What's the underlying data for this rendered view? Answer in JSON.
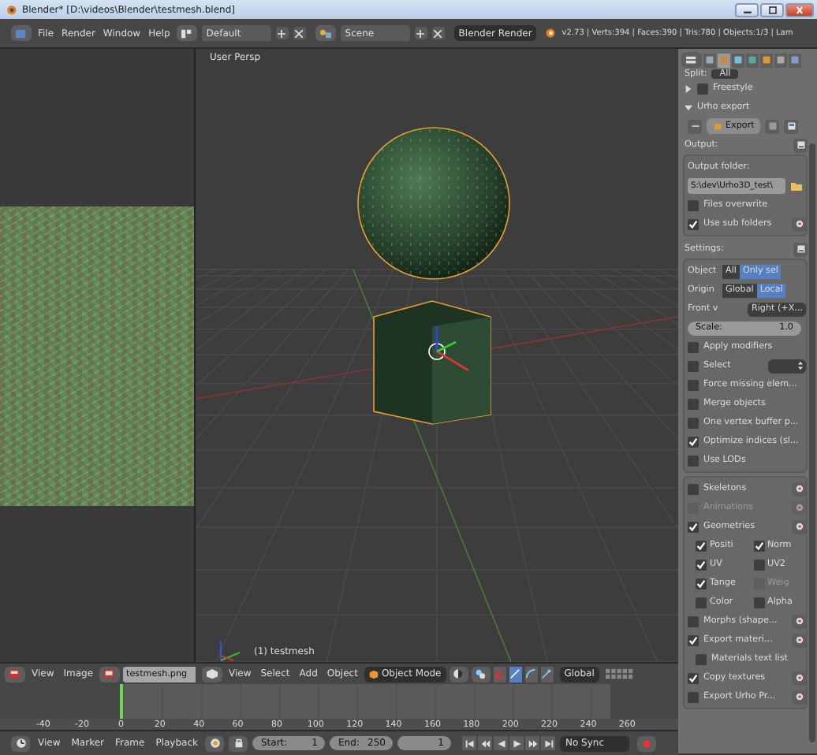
{
  "window": {
    "title": "Blender* [D:\\videos\\Blender\\testmesh.blend]"
  },
  "top_bar": {
    "menus": [
      "File",
      "Render",
      "Window",
      "Help"
    ],
    "layout": "Default",
    "scene": "Scene",
    "engine": "Blender Render",
    "stats": "v2.73 | Verts:394 | Faces:390 | Tris:780 | Objects:1/3 | Lam"
  },
  "image_editor": {
    "menus": [
      "View",
      "Image"
    ],
    "image_name": "testmesh.png"
  },
  "viewport": {
    "view_label": "User Persp",
    "object_label": "(1) testmesh",
    "menus": [
      "View",
      "Select",
      "Add",
      "Object"
    ],
    "mode": "Object Mode",
    "orientation": "Global"
  },
  "properties": {
    "tabs": [
      {
        "selected": false
      },
      {
        "selected": true
      },
      {
        "selected": false
      },
      {
        "selected": false
      },
      {
        "selected": false
      },
      {
        "selected": false
      },
      {
        "selected": false
      }
    ],
    "split": {
      "label": "Split:",
      "value": "All"
    },
    "freestyle": {
      "title": "Freestyle",
      "expanded": false,
      "checked": false
    },
    "urho_export": {
      "title": "Urho export",
      "expanded": true,
      "export_button": "Export",
      "sections": [
        {
          "title": "Output:",
          "rows": [
            {
              "kind": "label",
              "label": "Output folder:"
            },
            {
              "kind": "field",
              "value": "S:\\dev\\Urho3D_test\\"
            },
            {
              "kind": "checkbox",
              "label": "Files overwrite",
              "checked": false,
              "disabled": false,
              "icon_button": false
            },
            {
              "kind": "checkbox",
              "label": "Use sub folders",
              "checked": true,
              "disabled": false,
              "icon_button": true
            }
          ]
        },
        {
          "title": "Settings:",
          "rows": [
            {
              "kind": "toggle",
              "label": "Object",
              "options": [
                {
                  "label": "All",
                  "selected": false
                },
                {
                  "label": "Only sel",
                  "selected": true
                }
              ]
            },
            {
              "kind": "toggle",
              "label": "Origin",
              "options": [
                {
                  "label": "Global",
                  "selected": false
                },
                {
                  "label": "Local",
                  "selected": true
                }
              ]
            },
            {
              "kind": "dropdown",
              "label": "Front v",
              "value": "Right (+X..."
            },
            {
              "kind": "slider",
              "label": "Scale:",
              "value": "1.0"
            },
            {
              "kind": "checkbox",
              "label": "Apply modifiers",
              "checked": false,
              "disabled": false,
              "icon_button": false
            },
            {
              "kind": "checkbox_dropdown",
              "label": "Select",
              "checked": false,
              "disabled": false
            },
            {
              "kind": "checkbox",
              "label": "Force missing elem...",
              "checked": false,
              "disabled": false,
              "icon_button": false
            },
            {
              "kind": "checkbox",
              "label": "Merge objects",
              "checked": false,
              "disabled": false,
              "icon_button": false
            },
            {
              "kind": "checkbox",
              "label": "One vertex buffer p...",
              "checked": false,
              "disabled": false,
              "icon_button": false
            },
            {
              "kind": "checkbox",
              "label": "Optimize indices (sl...",
              "checked": true,
              "disabled": false,
              "icon_button": false
            },
            {
              "kind": "checkbox",
              "label": "Use LODs",
              "checked": false,
              "disabled": false,
              "icon_button": false
            }
          ]
        },
        {
          "rows": [
            {
              "kind": "checkbox",
              "label": "Skeletons",
              "checked": false,
              "disabled": false,
              "icon_button": true
            },
            {
              "kind": "checkbox",
              "label": "Animations",
              "checked": false,
              "disabled": true,
              "icon_button": true
            },
            {
              "kind": "checkbox",
              "label": "Geometries",
              "checked": true,
              "disabled": false,
              "icon_button": true
            },
            {
              "kind": "pair",
              "items": [
                {
                  "label": "Positi",
                  "checked": true,
                  "disabled": false
                },
                {
                  "label": "Norm",
                  "checked": true,
                  "disabled": false
                }
              ]
            },
            {
              "kind": "pair",
              "items": [
                {
                  "label": "UV",
                  "checked": true,
                  "disabled": false
                },
                {
                  "label": "UV2",
                  "checked": false,
                  "disabled": false
                }
              ]
            },
            {
              "kind": "pair",
              "items": [
                {
                  "label": "Tange",
                  "checked": true,
                  "disabled": false
                },
                {
                  "label": "Weig",
                  "checked": false,
                  "disabled": true
                }
              ]
            },
            {
              "kind": "pair",
              "items": [
                {
                  "label": "Color",
                  "checked": false,
                  "disabled": false
                },
                {
                  "label": "Alpha",
                  "checked": false,
                  "disabled": false
                }
              ]
            },
            {
              "kind": "checkbox",
              "label": "Morphs (shape...",
              "checked": false,
              "disabled": false,
              "icon_button": true
            },
            {
              "kind": "checkbox",
              "label": "Export materi...",
              "checked": true,
              "disabled": false,
              "icon_button": true,
              "children": [
                {
                  "kind": "checkbox",
                  "label": "Materials text list",
                  "checked": false,
                  "disabled": false
                }
              ]
            },
            {
              "kind": "checkbox",
              "label": "Copy textures",
              "checked": true,
              "disabled": false,
              "icon_button": true
            },
            {
              "kind": "checkbox",
              "label": "Export Urho Pr...",
              "checked": false,
              "disabled": false,
              "icon_button": true
            }
          ]
        }
      ]
    }
  },
  "timeline": {
    "ruler": [
      "-40",
      "-20",
      "0",
      "20",
      "40",
      "60",
      "80",
      "100",
      "120",
      "140",
      "160",
      "180",
      "200",
      "220",
      "240",
      "260"
    ],
    "menus": [
      "View",
      "Marker",
      "Frame",
      "Playback"
    ],
    "start": {
      "label": "Start:",
      "value": "1"
    },
    "end": {
      "label": "End:",
      "value": "250"
    },
    "current_frame": "1",
    "sync": "No Sync"
  }
}
